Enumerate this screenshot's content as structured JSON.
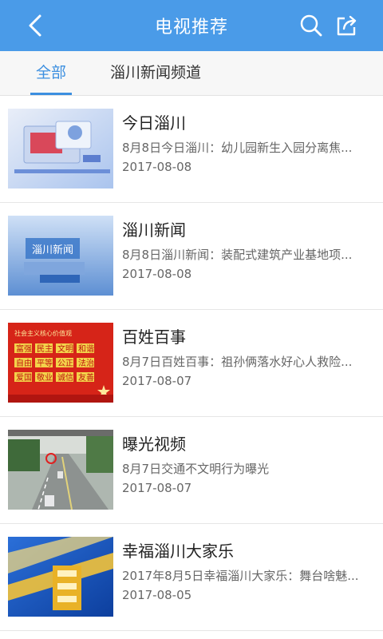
{
  "header": {
    "title": "电视推荐",
    "back_icon": "chevron-left-icon",
    "search_icon": "search-icon",
    "share_icon": "share-icon"
  },
  "tabs": [
    {
      "label": "全部",
      "active": true
    },
    {
      "label": "淄川新闻频道",
      "active": false
    }
  ],
  "items": [
    {
      "title": "今日淄川",
      "desc": "8月8日今日淄川：幼儿园新生入园分离焦...",
      "date": "2017-08-08"
    },
    {
      "title": "淄川新闻",
      "desc": "8月8日淄川新闻：装配式建筑产业基地项...",
      "date": "2017-08-08",
      "thumb_text": "淄川新闻"
    },
    {
      "title": "百姓百事",
      "desc": "8月7日百姓百事：祖孙俩落水好心人救险...",
      "date": "2017-08-07",
      "thumb_heading": "社会主义核心价值观",
      "thumb_words": [
        "富强",
        "民主",
        "文明",
        "和谐",
        "自由",
        "平等",
        "公正",
        "法治",
        "爱国",
        "敬业",
        "诚信",
        "友善"
      ]
    },
    {
      "title": "曝光视频",
      "desc": "8月7日交通不文明行为曝光",
      "date": "2017-08-07"
    },
    {
      "title": "幸福淄川大家乐",
      "desc": "2017年8月5日幸福淄川大家乐：舞台啥魅...",
      "date": "2017-08-05"
    }
  ],
  "colors": {
    "header_bg": "#4a9be8",
    "tab_active": "#3c8fe0"
  }
}
